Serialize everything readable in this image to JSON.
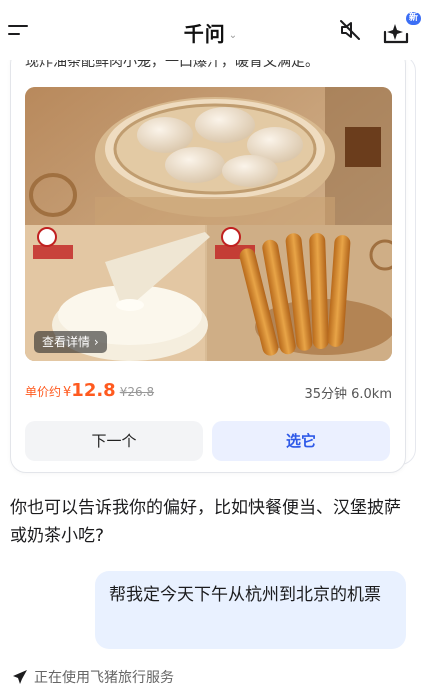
{
  "header": {
    "title": "千问",
    "chevron": "⌄",
    "new_badge": "新"
  },
  "icons": {
    "menu": "menu-icon",
    "chevron": "chevron-down-icon",
    "mute": "speaker-muted-icon",
    "new_chat": "new-chat-sparkle-icon",
    "plane": "plane-icon"
  },
  "card": {
    "description": "现炸油条配鲜肉小笼，一口爆汁，暖胃又满足。",
    "detail_button": "查看详情 ›",
    "price_label": "单价约",
    "currency": "¥",
    "price": "12.8",
    "original_price": "¥26.8",
    "eta": "35分钟 6.0km",
    "next_button": "下一个",
    "pick_button": "选它"
  },
  "chat": {
    "bot_message": "你也可以告诉我你的偏好，比如快餐便当、汉堡披萨或奶茶小吃?",
    "user_message": "帮我定今天下午从杭州到北京的机票",
    "service_status": "正在使用飞猪旅行服务"
  },
  "colors": {
    "accent": "#2f5ae8",
    "price": "#ff5a1f",
    "user_bubble": "#e9f1ff",
    "pick_button_bg": "#ebf0ff"
  }
}
